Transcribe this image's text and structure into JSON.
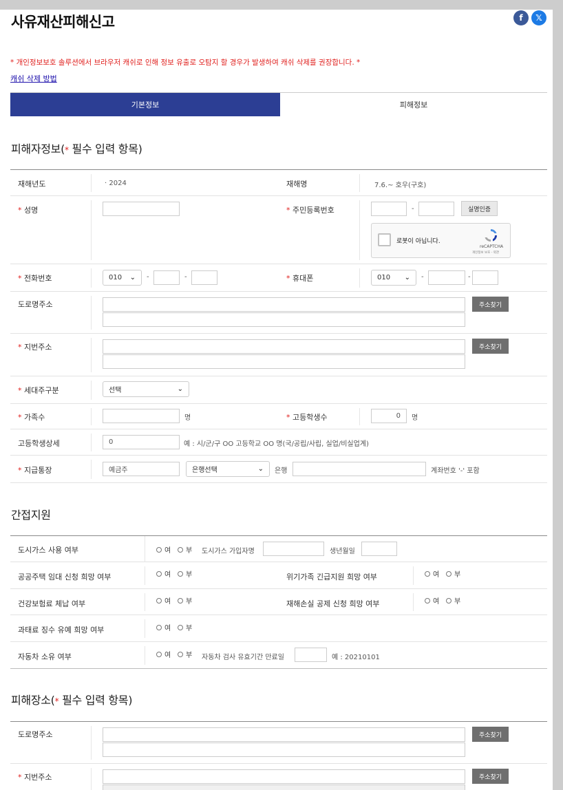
{
  "header": {
    "title": "사유재산피해신고",
    "notice": "* 개인정보보호 솔루션에서 브라우저 캐쉬로 인해 정보 유출로 오탐지 할 경우가 발생하여 캐쉬 삭제를 권장합니다. *",
    "cache_link": "캐쉬 삭제 방법",
    "facebook": "f",
    "twitter": "𝕏"
  },
  "tabs": {
    "basic": "기본정보",
    "damage": "피해정보"
  },
  "victim": {
    "title_prefix": "피해자정보(",
    "title_star": "*",
    "title_suffix": " 필수 입력 항목)",
    "year_label": "재해년도",
    "year_value": "· 2024",
    "disaster_label": "재해명",
    "disaster_value": "7.6.~ 호우(구호)",
    "name_label": "성명",
    "rrn_label": "주민등록번호",
    "dash": "-",
    "verify_button": "실명인증",
    "captcha_text": "로봇이 아닙니다.",
    "captcha_brand": "reCAPTCHA",
    "captcha_terms": "개인정보 보호 - 약관",
    "phone_label": "전화번호",
    "phone_prefix": "010",
    "mobile_label": "휴대폰",
    "mobile_prefix": "010",
    "road_label": "도로명주소",
    "find_button": "주소찾기",
    "lot_label": "지번주소",
    "household_label": "세대주구분",
    "household_value": "선택",
    "family_label": "가족수",
    "unit_person": "명",
    "hs_count_label": "고등학생수",
    "hs_count_value": "0",
    "hs_detail_label": "고등학생상세",
    "hs_detail_value": "0",
    "hs_detail_hint": "예 : 시/군/구 OO 고등학교 OO 명(국/공립/사립, 실업/비실업계)",
    "account_label": "지급통장",
    "holder_placeholder": "예금주",
    "bank_select": "은행선택",
    "bank_suffix": "은행",
    "account_hint": "계좌번호 '-' 포함"
  },
  "indirect": {
    "title": "간접지원",
    "yes": "여",
    "no": "부",
    "gas_label": "도시가스 사용 여부",
    "gas_joiner_label": "도시가스 가입자명",
    "birth_label": "생년월일",
    "housing_label": "공공주택 임대 신청 희망 여부",
    "crisis_label": "위기가족 긴급지원 희망 여부",
    "health_label": "건강보험료 체납 여부",
    "deduction_label": "재해손실 공제 신청 희망 여부",
    "fine_label": "과태료 징수 유예 희망 여부",
    "car_label": "자동차 소유 여부",
    "car_inspect_label": "자동차 검사 유효기간 만료일",
    "car_hint": "예 : 20210101"
  },
  "place": {
    "title_prefix": "피해장소(",
    "title_star": "*",
    "title_suffix": " 필수 입력 항목)",
    "road_label": "도로명주소",
    "lot_label": "지번주소",
    "find_button": "주소찾기"
  }
}
